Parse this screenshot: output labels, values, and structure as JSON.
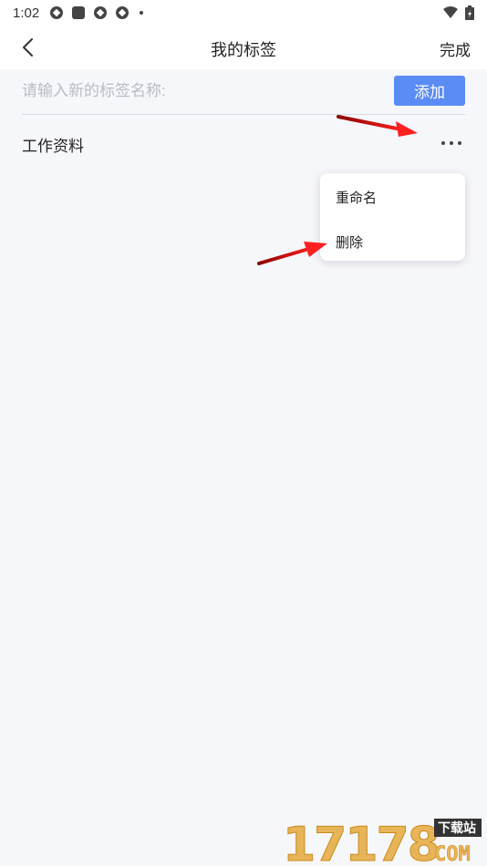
{
  "status_bar": {
    "time": "1:02"
  },
  "header": {
    "title": "我的标签",
    "done_label": "完成"
  },
  "add_tag": {
    "placeholder": "请输入新的标签名称:",
    "value": "",
    "button_label": "添加"
  },
  "tags": [
    {
      "name": "工作资料"
    }
  ],
  "context_menu": {
    "items": [
      {
        "label": "重命名"
      },
      {
        "label": "删除"
      }
    ]
  },
  "watermark": {
    "number": "17178",
    "label": "下载站",
    "domain": "COM"
  },
  "colors": {
    "accent": "#5b8cf5",
    "background": "#f6f7fa",
    "annotation_arrow": "#e01010",
    "watermark": "#e8b458"
  }
}
